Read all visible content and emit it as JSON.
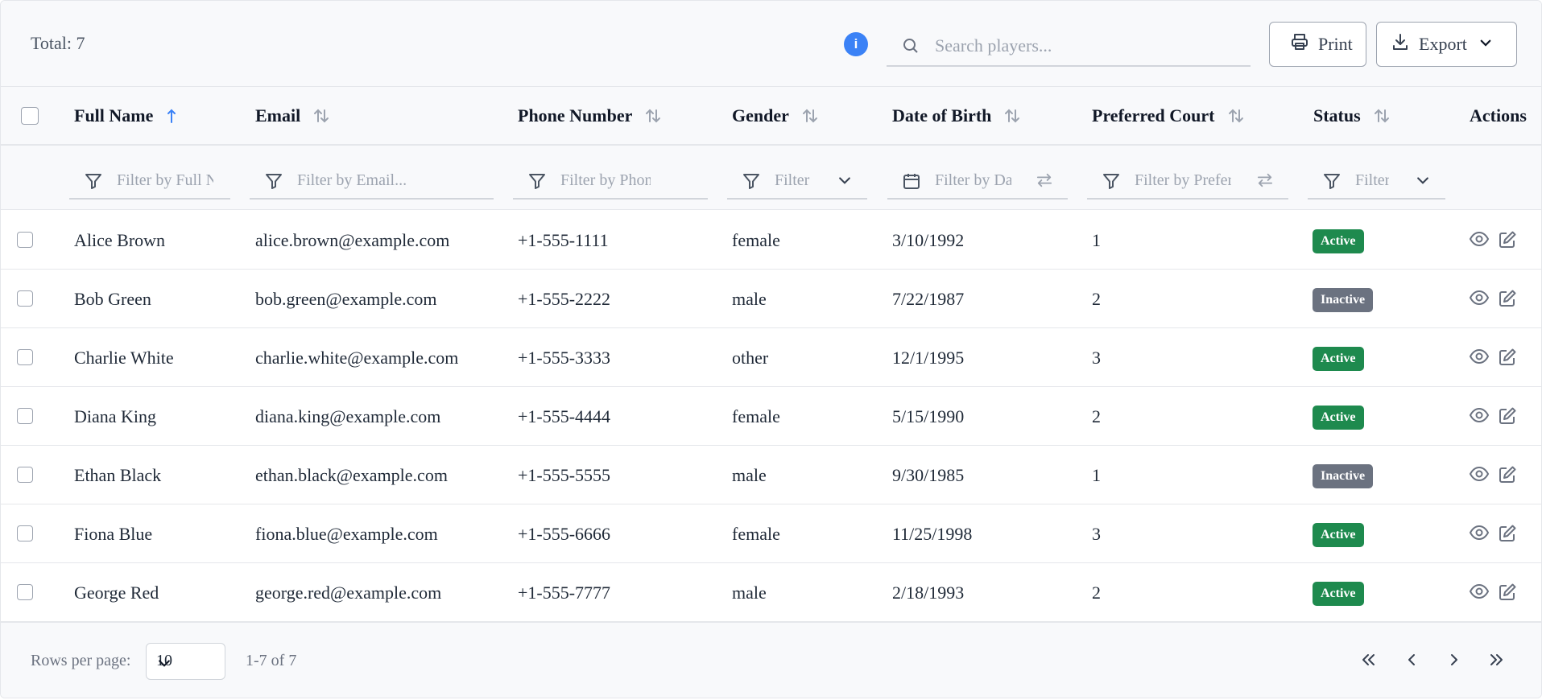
{
  "toolbar": {
    "total": "Total: 7",
    "info": "i",
    "search_placeholder": "Search players...",
    "print_label": "Print",
    "export_label": "Export"
  },
  "columns": [
    "Full Name",
    "Email",
    "Phone Number",
    "Gender",
    "Date of Birth",
    "Preferred Court",
    "Status",
    "Actions"
  ],
  "filters": {
    "full_name": "Filter by Full Name...",
    "email": "Filter by Email...",
    "phone": "Filter by Phone Number...",
    "gender": "Filter by Gender...",
    "dob": "Filter by Date of Birth...",
    "court": "Filter by Preferred Court...",
    "status": "Filter by Status..."
  },
  "rows": [
    {
      "name": "Alice Brown",
      "email": "alice.brown@example.com",
      "phone": "+1-555-1111",
      "gender": "female",
      "dob": "3/10/1992",
      "court": "1",
      "status": "Active"
    },
    {
      "name": "Bob Green",
      "email": "bob.green@example.com",
      "phone": "+1-555-2222",
      "gender": "male",
      "dob": "7/22/1987",
      "court": "2",
      "status": "Inactive"
    },
    {
      "name": "Charlie White",
      "email": "charlie.white@example.com",
      "phone": "+1-555-3333",
      "gender": "other",
      "dob": "12/1/1995",
      "court": "3",
      "status": "Active"
    },
    {
      "name": "Diana King",
      "email": "diana.king@example.com",
      "phone": "+1-555-4444",
      "gender": "female",
      "dob": "5/15/1990",
      "court": "2",
      "status": "Active"
    },
    {
      "name": "Ethan Black",
      "email": "ethan.black@example.com",
      "phone": "+1-555-5555",
      "gender": "male",
      "dob": "9/30/1985",
      "court": "1",
      "status": "Inactive"
    },
    {
      "name": "Fiona Blue",
      "email": "fiona.blue@example.com",
      "phone": "+1-555-6666",
      "gender": "female",
      "dob": "11/25/1998",
      "court": "3",
      "status": "Active"
    },
    {
      "name": "George Red",
      "email": "george.red@example.com",
      "phone": "+1-555-7777",
      "gender": "male",
      "dob": "2/18/1993",
      "court": "2",
      "status": "Active"
    }
  ],
  "footer": {
    "rows_per_page_label": "Rows per page:",
    "rows_per_page": "10",
    "range": "1-7 of 7"
  },
  "colors": {
    "active": "#1e8a4e",
    "inactive": "#6b7280",
    "sort_active": "#3b82f6",
    "info": "#3b82f6"
  },
  "icons": {
    "search": "search-icon",
    "print": "printer-icon",
    "export": "download-icon",
    "filter": "filter-icon",
    "calendar": "calendar-icon",
    "view": "eye-icon",
    "edit": "edit-icon"
  }
}
